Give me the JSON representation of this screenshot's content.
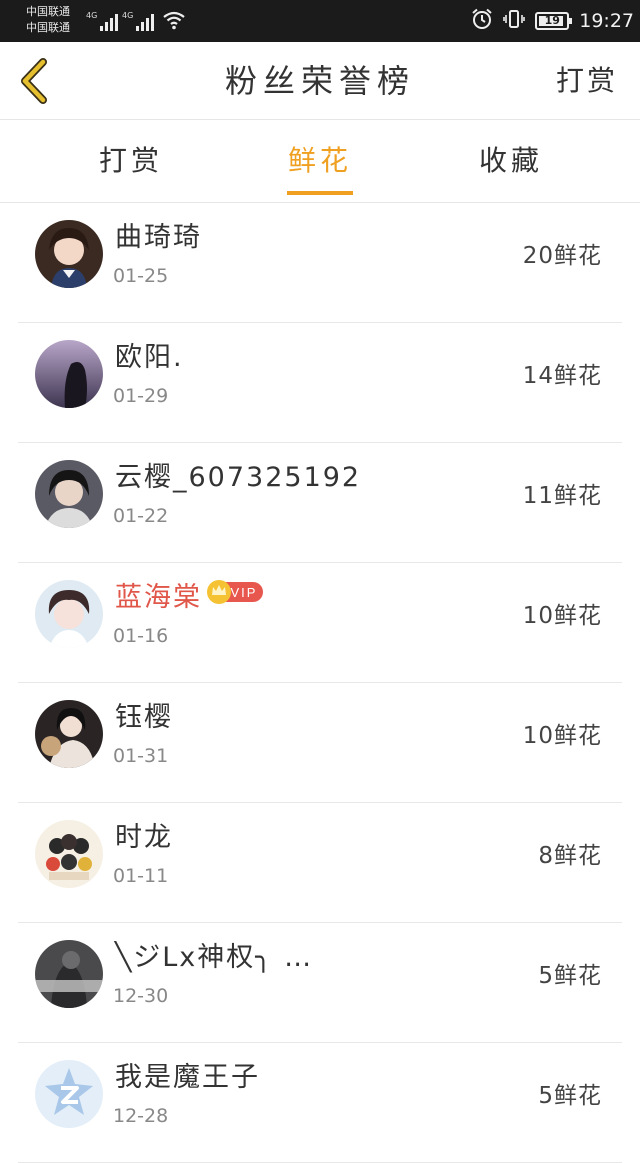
{
  "status_bar": {
    "carrier_1": "中国联通",
    "carrier_2": "中国联通",
    "network_1": "4G",
    "network_2": "4G",
    "battery": "19",
    "time": "19:27",
    "icons": [
      "signal-icon",
      "wifi-icon",
      "alarm-icon",
      "vibrate-icon",
      "battery-icon"
    ]
  },
  "header": {
    "title": "粉丝荣誉榜",
    "action": "打赏",
    "back_icon": "chevron-left-icon",
    "accent": "#e6bf2e"
  },
  "tabs": [
    {
      "label": "打赏",
      "active": false
    },
    {
      "label": "鲜花",
      "active": true
    },
    {
      "label": "收藏",
      "active": false
    }
  ],
  "accent_color": "#f0a020",
  "fans": [
    {
      "name": "曲琦琦",
      "date": "01-25",
      "count": "20鲜花",
      "vip": false
    },
    {
      "name": "欧阳.",
      "date": "01-29",
      "count": "14鲜花",
      "vip": false
    },
    {
      "name": "云樱_607325192",
      "date": "01-22",
      "count": "11鲜花",
      "vip": false
    },
    {
      "name": "蓝海棠",
      "date": "01-16",
      "count": "10鲜花",
      "vip": true,
      "vip_label": "VIP"
    },
    {
      "name": "钰樱",
      "date": "01-31",
      "count": "10鲜花",
      "vip": false
    },
    {
      "name": "时龙",
      "date": "01-11",
      "count": "8鲜花",
      "vip": false
    },
    {
      "name": "╲ジLx神权╮ …",
      "date": "12-30",
      "count": "5鲜花",
      "vip": false
    },
    {
      "name": "我是魔王子",
      "date": "12-28",
      "count": "5鲜花",
      "vip": false
    }
  ]
}
